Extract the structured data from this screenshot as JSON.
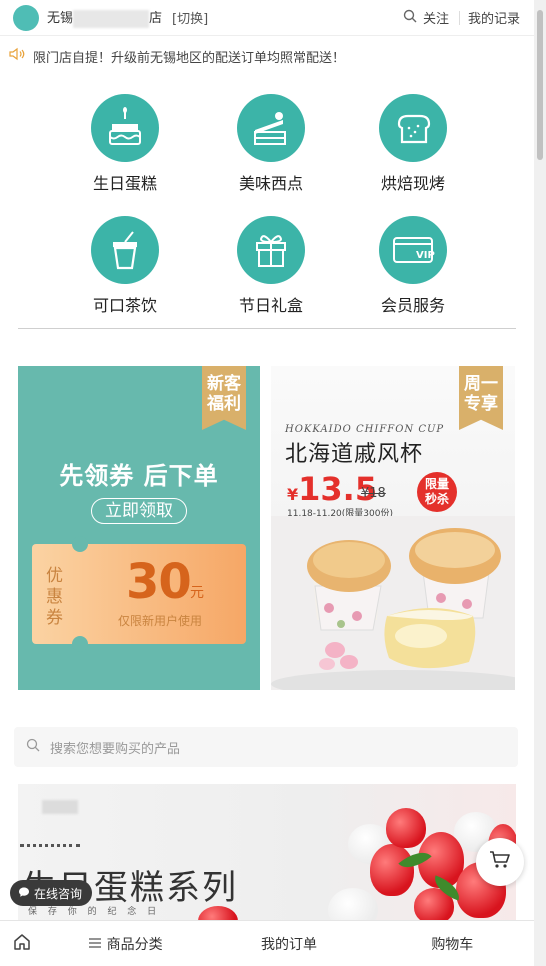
{
  "header": {
    "store_prefix": "无锡",
    "store_suffix": "店",
    "switch_label": "[切换]",
    "follow_label": "关注",
    "records_label": "我的记录"
  },
  "notice": {
    "text": "限门店自提！升级前无锡地区的配送订单均照常配送！"
  },
  "categories": [
    {
      "label": "生日蛋糕",
      "icon": "cake-icon"
    },
    {
      "label": "美味西点",
      "icon": "pastry-icon"
    },
    {
      "label": "烘焙现烤",
      "icon": "bread-icon"
    },
    {
      "label": "可口茶饮",
      "icon": "drink-icon"
    },
    {
      "label": "节日礼盒",
      "icon": "gift-icon"
    },
    {
      "label": "会员服务",
      "icon": "vip-card-icon"
    }
  ],
  "banner_left": {
    "ribbon": "新客\n福利",
    "title": "先领券 后下单",
    "button": "立即领取",
    "coupon_label": "优惠券",
    "coupon_value": "30",
    "coupon_unit": "元",
    "coupon_note": "仅限新用户使用"
  },
  "banner_right": {
    "ribbon": "周一\n专享",
    "en_title": "HOKKAIDO CHIFFON CUP",
    "title": "北海道戚风杯",
    "currency": "¥",
    "price": "13.5",
    "old_price": "¥18",
    "date_note": "11.18-11.20(限量300份)",
    "badge": "限量\n秒杀"
  },
  "search": {
    "placeholder": "搜索您想要购买的产品"
  },
  "promo": {
    "title": "生日蛋糕系列",
    "subtitle": "保 存 你 的 纪 念 日"
  },
  "chat_label": "在线咨询",
  "bottom_nav": {
    "category": "商品分类",
    "orders": "我的订单",
    "cart": "购物车"
  },
  "colors": {
    "accent": "#3cb4a8",
    "price_red": "#e4302b",
    "ribbon_gold": "#d9b06a"
  }
}
